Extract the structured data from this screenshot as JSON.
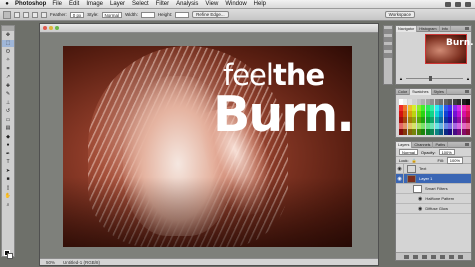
{
  "menubar": {
    "app_name": "Photoshop",
    "items": [
      "File",
      "Edit",
      "Image",
      "Layer",
      "Select",
      "Filter",
      "Analysis",
      "View",
      "Window",
      "Help"
    ]
  },
  "options": {
    "feather_label": "Feather:",
    "feather_value": "0 px",
    "style_label": "Style:",
    "style_value": "Normal",
    "width_label": "Width:",
    "height_label": "Height:",
    "refine_button": "Refine Edge...",
    "workspace_button": "Workspace"
  },
  "document": {
    "zoom": "50%",
    "status_text": "Untitled-1 (RGB/8)",
    "headline_light": "feel",
    "headline_bold": "the",
    "headline_big": "Burn."
  },
  "navigator": {
    "tabs": [
      "Navigator",
      "Histogram",
      "Info"
    ],
    "thumb_text": "Burn."
  },
  "color_panel": {
    "tabs": [
      "Color",
      "Swatches",
      "Styles"
    ]
  },
  "layers_panel": {
    "tabs": [
      "Layers",
      "Channels",
      "Paths"
    ],
    "blend_mode": "Normal",
    "opacity_label": "Opacity:",
    "opacity_value": "100%",
    "lock_label": "Lock:",
    "fill_label": "Fill:",
    "fill_value": "100%",
    "rows": [
      {
        "name": "Text"
      },
      {
        "name": "Layer 1"
      },
      {
        "name": "Smart Filters"
      },
      {
        "name": "Halftone Pattern"
      },
      {
        "name": "Diffuse Glow"
      }
    ]
  },
  "colors": {
    "accent_select": "#3a66b4",
    "image_tint": "#8c3b28"
  }
}
